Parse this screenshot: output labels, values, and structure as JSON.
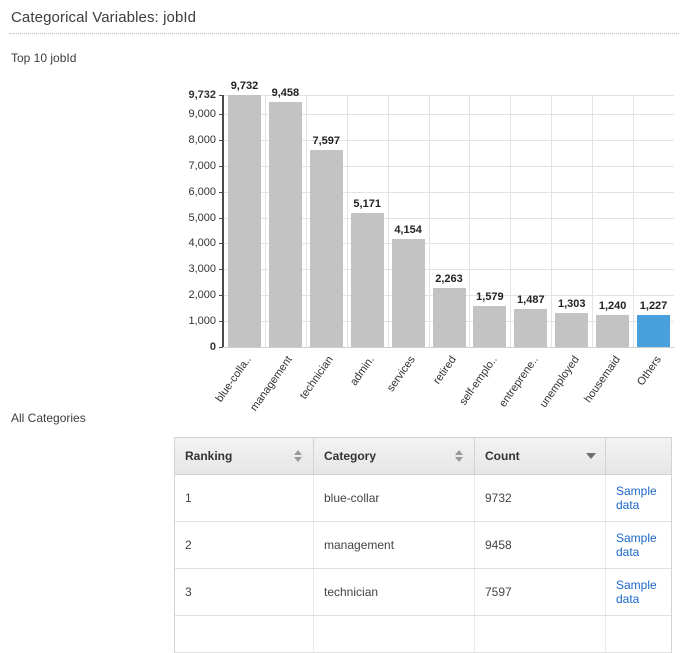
{
  "header": {
    "title": "Categorical Variables: jobId"
  },
  "sections": {
    "chart_label": "Top 10 jobId",
    "table_label": "All Categories"
  },
  "chart_data": {
    "type": "bar",
    "title": "Top 10 jobId",
    "xlabel": "",
    "ylabel": "",
    "ylim": [
      0,
      9732
    ],
    "grid": true,
    "legend": "none",
    "yticks": [
      "0",
      "1,000",
      "2,000",
      "3,000",
      "4,000",
      "5,000",
      "6,000",
      "7,000",
      "8,000",
      "9,000",
      "9,732"
    ],
    "max_tick": "9,732",
    "categories": [
      "blue-colla..",
      "management",
      "technician",
      "admin.",
      "services",
      "retired",
      "self-emplo..",
      "entreprene..",
      "unemployed",
      "housemaid",
      "Others"
    ],
    "values": [
      9732,
      9458,
      7597,
      5171,
      4154,
      2263,
      1579,
      1487,
      1303,
      1240,
      1227
    ],
    "value_labels": [
      "9,732",
      "9,458",
      "7,597",
      "5,171",
      "4,154",
      "2,263",
      "1,579",
      "1,487",
      "1,303",
      "1,240",
      "1,227"
    ],
    "bar_color": "#c3c3c3",
    "highlight_color": "#49a0dc",
    "highlight_index": 10
  },
  "table": {
    "columns": [
      "Ranking",
      "Category",
      "Count",
      ""
    ],
    "sort": {
      "ranking_icon": "sort-both-icon",
      "category_icon": "sort-both-icon",
      "count_icon": "sort-descending-icon"
    },
    "rows": [
      {
        "ranking": "1",
        "category": "blue-collar",
        "count": "9732",
        "action": "Sample data"
      },
      {
        "ranking": "2",
        "category": "management",
        "count": "9458",
        "action": "Sample data"
      },
      {
        "ranking": "3",
        "category": "technician",
        "count": "7597",
        "action": "Sample data"
      }
    ]
  },
  "colors": {
    "link": "#1a66c9",
    "bar": "#c3c3c3",
    "accent": "#49a0dc"
  }
}
